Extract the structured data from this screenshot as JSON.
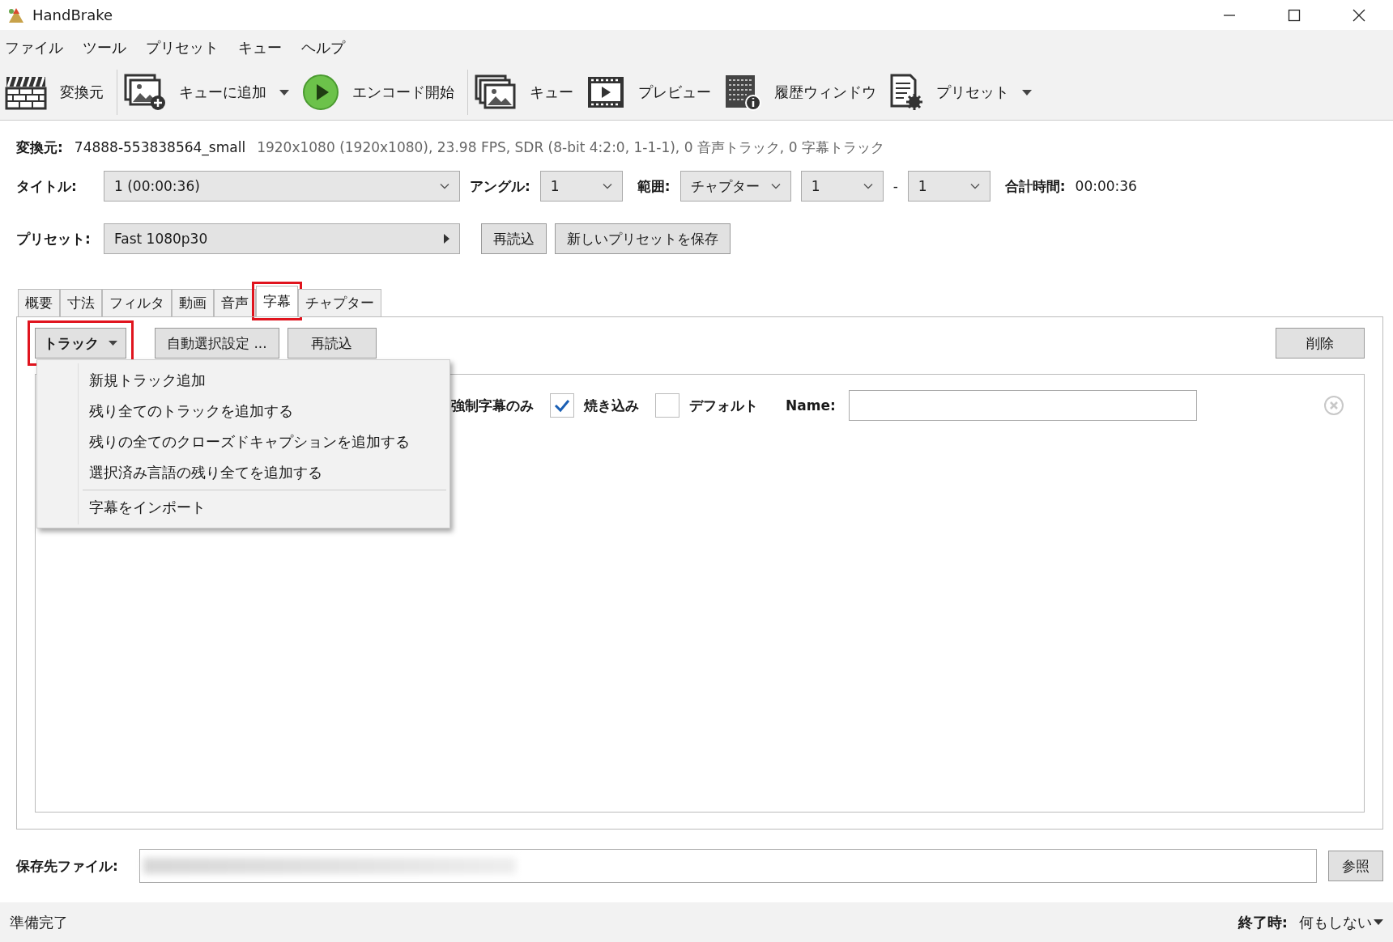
{
  "window": {
    "title": "HandBrake"
  },
  "menu": [
    "ファイル",
    "ツール",
    "プリセット",
    "キュー",
    "ヘルプ"
  ],
  "toolbar": [
    [
      {
        "kind": "clapper",
        "label": "変換元",
        "dropdown": false
      }
    ],
    [
      {
        "kind": "add-queue",
        "label": "キューに追加",
        "dropdown": true
      },
      {
        "kind": "play",
        "label": "エンコード開始",
        "dropdown": false
      }
    ],
    [
      {
        "kind": "queue",
        "label": "キュー",
        "dropdown": false
      },
      {
        "kind": "preview",
        "label": "プレビュー",
        "dropdown": false
      },
      {
        "kind": "log",
        "label": "履歴ウィンドウ",
        "dropdown": false
      },
      {
        "kind": "preset",
        "label": "プリセット",
        "dropdown": true
      }
    ]
  ],
  "source": {
    "label": "変換元:",
    "name": "74888-553838564_small",
    "details": "1920x1080 (1920x1080), 23.98 FPS, SDR (8-bit 4:2:0, 1-1-1), 0 音声トラック, 0 字幕トラック"
  },
  "title_row": {
    "title_label": "タイトル:",
    "title_value": "1  (00:00:36)",
    "angle_label": "アングル:",
    "angle_value": "1",
    "range_label": "範囲:",
    "range_mode": "チャプター",
    "range_start": "1",
    "range_dash": "-",
    "range_end": "1",
    "duration_label": "合計時間:",
    "duration_value": "00:00:36"
  },
  "preset_row": {
    "label": "プリセット:",
    "value": "Fast 1080p30",
    "buttons": [
      "再読込",
      "新しいプリセットを保存"
    ]
  },
  "tabs": [
    {
      "label": "概要",
      "selected": false,
      "highlighted": false
    },
    {
      "label": "寸法",
      "selected": false,
      "highlighted": false
    },
    {
      "label": "フィルタ",
      "selected": false,
      "highlighted": false
    },
    {
      "label": "動画",
      "selected": false,
      "highlighted": false
    },
    {
      "label": "音声",
      "selected": false,
      "highlighted": false
    },
    {
      "label": "字幕",
      "selected": true,
      "highlighted": true
    },
    {
      "label": "チャプター",
      "selected": false,
      "highlighted": false
    }
  ],
  "subtitles": {
    "track_button": {
      "label": "トラック",
      "highlighted": true
    },
    "auto_button": "自動選択設定 ...",
    "reload_button": "再読込",
    "delete_button": "削除",
    "track_menu": [
      {
        "kind": "item",
        "label": "新規トラック追加"
      },
      {
        "kind": "item",
        "label": "残り全てのトラックを追加する"
      },
      {
        "kind": "item",
        "label": "残りの全てのクローズドキャプションを追加する"
      },
      {
        "kind": "item",
        "label": "選択済み言語の残り全てを追加する"
      },
      {
        "kind": "separator"
      },
      {
        "kind": "item",
        "label": "字幕をインポート"
      }
    ],
    "row": {
      "forced_label": "強制字幕のみ",
      "options": [
        {
          "label": "焼き込み",
          "checked": true
        },
        {
          "label": "デフォルト",
          "checked": false
        }
      ],
      "name_label": "Name:"
    }
  },
  "destination": {
    "label": "保存先ファイル:",
    "blurred": true,
    "browse": "参照"
  },
  "status_bar": {
    "text": "準備完了",
    "when_done_label": "終了時:",
    "when_done_value": "何もしない"
  }
}
